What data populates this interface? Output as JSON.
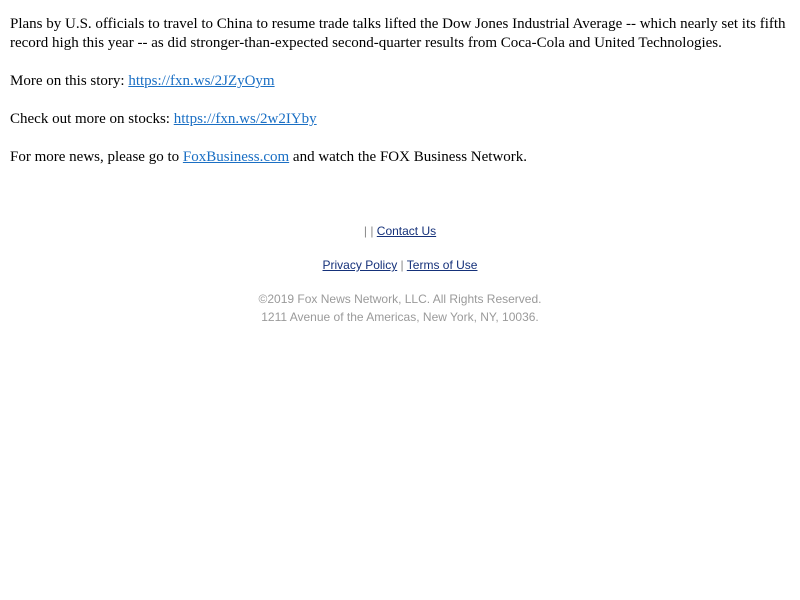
{
  "article": {
    "paragraph1": "Plans by U.S. officials to travel to China to resume trade talks lifted the Dow Jones Industrial Average -- which nearly set its fifth record high this year -- as did stronger-than-expected second-quarter results from Coca-Cola and United Technologies.",
    "more_story_label": "More on this story: ",
    "more_story_link": "https://fxn.ws/2JZyOym",
    "stocks_label": "Check out more on stocks: ",
    "stocks_link": "https://fxn.ws/2w2IYby",
    "news_prefix": "For more news, please go to ",
    "news_link": "FoxBusiness.com",
    "news_suffix": " and watch the FOX Business Network."
  },
  "footer": {
    "separator1": "|",
    "separator2": "|",
    "contact_link": "Contact Us",
    "privacy_link": "Privacy Policy",
    "policy_separator": "|",
    "terms_link": "Terms of Use",
    "copyright": "©2019 Fox News Network, LLC. All Rights Reserved.",
    "address": "1211 Avenue of the Americas, New York, NY, 10036."
  },
  "colors": {
    "link": "#1a6fc4",
    "footer_link": "#15317a",
    "legal_text": "#9a9a9a"
  }
}
